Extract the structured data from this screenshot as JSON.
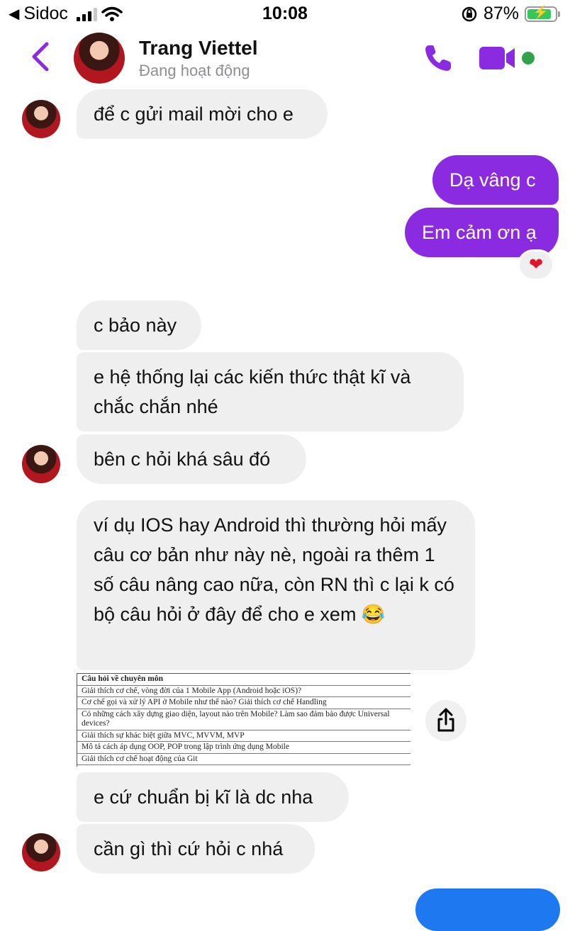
{
  "status_bar": {
    "carrier": "Sidoc",
    "time": "10:08",
    "battery": "87%"
  },
  "header": {
    "name": "Trang Viettel",
    "status": "Đang hoạt động"
  },
  "messages": [
    {
      "from": "them",
      "text": "để c gửi mail mời cho e"
    },
    {
      "from": "me",
      "text": "Dạ vâng c"
    },
    {
      "from": "me",
      "text": "Em cảm ơn ạ",
      "reaction": "❤"
    },
    {
      "from": "them",
      "text": "c bảo này"
    },
    {
      "from": "them",
      "text": "e hệ thống lại các kiến thức thật kĩ và chắc chắn nhé"
    },
    {
      "from": "them",
      "text": "bên c hỏi khá sâu đó"
    },
    {
      "from": "them",
      "text": "ví dụ IOS hay Android thì thường hỏi mấy câu cơ bản như này nè, ngoài ra thêm 1 số câu nâng cao nữa, còn RN thì c lại k có bộ câu hỏi ở đây để cho e xem 😂"
    },
    {
      "from": "them",
      "text": "e cứ chuẩn bị kĩ là dc nha"
    },
    {
      "from": "them",
      "text": "cần gì thì cứ hỏi c nhá"
    }
  ],
  "attachment": {
    "rows": [
      "Câu hỏi về chuyên môn",
      "Giải thích cơ chế, vòng đời của 1 Mobile App (Android hoặc iOS)?",
      "Cơ chế gọi và xử lý API ở Mobile như thế nào? Giải thích cơ chế Handling",
      "Có những cách xây dựng giao diện, layout nào trên Mobile? Làm sao đảm bảo được Universal devices?",
      "Giải thích sự khác biệt giữa MVC, MVVM, MVP",
      "Mô tả cách áp dụng OOP, POP trong lập trình ứng dụng Mobile",
      "Giải thích cơ chế hoạt động của Git"
    ]
  },
  "colors": {
    "outgoing_bubble": "#8a2be2",
    "incoming_bubble": "#efefef",
    "accent": "#8a2be2",
    "online": "#31a24c"
  }
}
